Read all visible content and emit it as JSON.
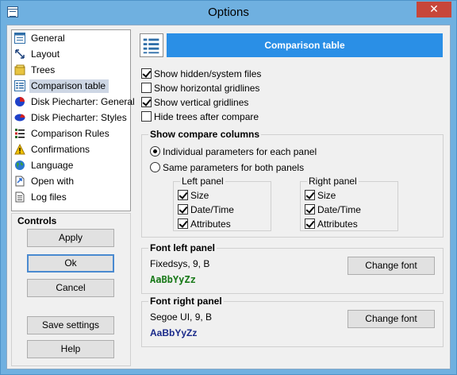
{
  "window": {
    "title": "Options",
    "close_label": "✕"
  },
  "tree": {
    "items": [
      {
        "label": "General",
        "icon": "general-icon"
      },
      {
        "label": "Layout",
        "icon": "layout-icon"
      },
      {
        "label": "Trees",
        "icon": "trees-icon"
      },
      {
        "label": "Comparison table",
        "icon": "comparison-table-icon",
        "selected": true
      },
      {
        "label": "Disk Piecharter: General",
        "icon": "piechart-icon"
      },
      {
        "label": "Disk Piecharter: Styles",
        "icon": "piechart-styles-icon"
      },
      {
        "label": "Comparison Rules",
        "icon": "rules-icon"
      },
      {
        "label": "Confirmations",
        "icon": "warning-icon"
      },
      {
        "label": "Language",
        "icon": "globe-icon"
      },
      {
        "label": "Open with",
        "icon": "open-with-icon"
      },
      {
        "label": "Log files",
        "icon": "log-files-icon"
      }
    ]
  },
  "controls": {
    "title": "Controls",
    "apply": "Apply",
    "ok": "Ok",
    "cancel": "Cancel",
    "save_settings": "Save settings",
    "help": "Help"
  },
  "panel": {
    "header": "Comparison table",
    "options": [
      {
        "label": "Show hidden/system files",
        "checked": true
      },
      {
        "label": "Show horizontal gridlines",
        "checked": false
      },
      {
        "label": "Show vertical gridlines",
        "checked": true
      },
      {
        "label": "Hide trees after compare",
        "checked": false
      }
    ],
    "compare_columns": {
      "title": "Show compare columns",
      "radio_individual": "Individual parameters for each panel",
      "radio_same": "Same parameters for both panels",
      "selected": "individual",
      "left_panel": {
        "title": "Left panel",
        "size": "Size",
        "datetime": "Date/Time",
        "attributes": "Attributes"
      },
      "right_panel": {
        "title": "Right panel",
        "size": "Size",
        "datetime": "Date/Time",
        "attributes": "Attributes"
      }
    },
    "font_left": {
      "title": "Font left panel",
      "font_desc": "Fixedsys, 9, B",
      "sample": "AaBbYyZz",
      "sample_color": "#1a7a1a",
      "change_button": "Change font"
    },
    "font_right": {
      "title": "Font right panel",
      "font_desc": "Segoe UI, 9, B",
      "sample": "AaBbYyZz",
      "sample_color": "#1a2a8a",
      "change_button": "Change font"
    }
  },
  "colors": {
    "header_bg": "#2a8fe6",
    "selection": "#cdd6e4"
  }
}
